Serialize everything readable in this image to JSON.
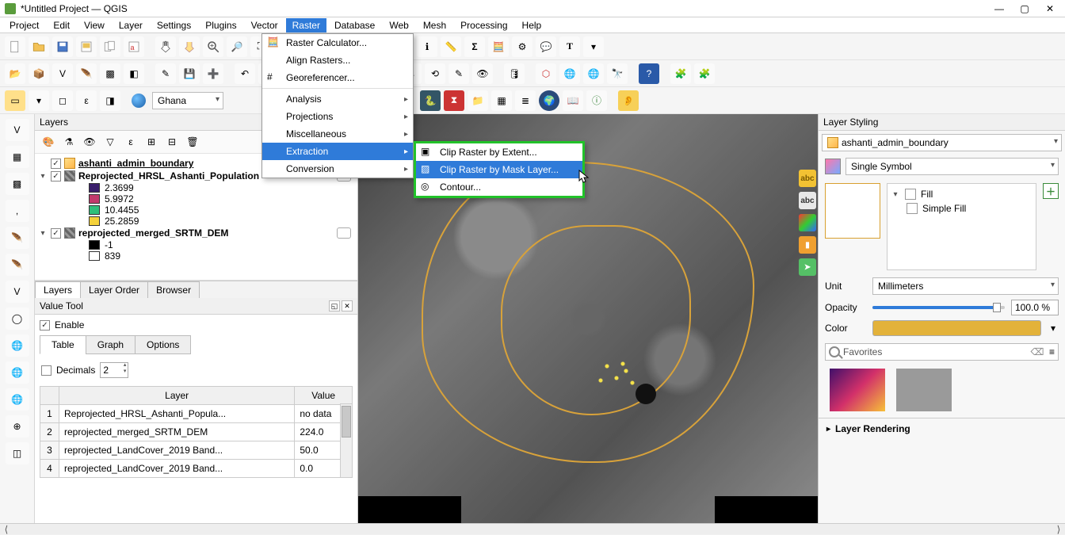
{
  "window": {
    "title": "*Untitled Project — QGIS"
  },
  "menu": {
    "items": [
      "Project",
      "Edit",
      "View",
      "Layer",
      "Settings",
      "Plugins",
      "Vector",
      "Raster",
      "Database",
      "Web",
      "Mesh",
      "Processing",
      "Help"
    ],
    "active": "Raster"
  },
  "raster_menu": {
    "items": [
      {
        "label": "Raster Calculator...",
        "icon": "calculator-icon"
      },
      {
        "label": "Align Rasters...",
        "icon": ""
      },
      {
        "label": "Georeferencer...",
        "icon": "georef-icon"
      },
      {
        "label": "Analysis",
        "submenu": true
      },
      {
        "label": "Projections",
        "submenu": true
      },
      {
        "label": "Miscellaneous",
        "submenu": true
      },
      {
        "label": "Extraction",
        "submenu": true,
        "hover": true
      },
      {
        "label": "Conversion",
        "submenu": true
      }
    ]
  },
  "extraction_submenu": {
    "items": [
      {
        "label": "Clip Raster by Extent...",
        "icon": "clip-extent-icon"
      },
      {
        "label": "Clip Raster by Mask Layer...",
        "icon": "clip-mask-icon",
        "hover": true
      },
      {
        "label": "Contour...",
        "icon": "contour-icon"
      }
    ]
  },
  "toolbar": {
    "location_combo": "Ghana"
  },
  "panels": {
    "layers_title": "Layers",
    "value_tool_title": "Value Tool",
    "layer_styling_title": "Layer Styling"
  },
  "layers": {
    "tree": [
      {
        "type": "vector",
        "name": "ashanti_admin_boundary",
        "checked": true,
        "underline": true
      },
      {
        "type": "raster",
        "name": "Reprojected_HRSL_Ashanti_Population",
        "checked": true,
        "expanded": true,
        "legend": [
          {
            "color": "#3a1e6b",
            "label": "2.3699"
          },
          {
            "color": "#c23a6b",
            "label": "5.9972"
          },
          {
            "color": "#2fbf7a",
            "label": "10.4455"
          },
          {
            "color": "#f5d23a",
            "label": "25.2859"
          }
        ]
      },
      {
        "type": "raster",
        "name": "reprojected_merged_SRTM_DEM",
        "checked": true,
        "expanded": true,
        "legend": [
          {
            "color": "#000000",
            "label": "-1"
          },
          {
            "color": "#ffffff",
            "label": "839"
          }
        ]
      }
    ],
    "tabs": [
      "Layers",
      "Layer Order",
      "Browser"
    ],
    "active_tab": "Layers"
  },
  "value_tool": {
    "enable_label": "Enable",
    "enable_checked": true,
    "tabs": [
      "Table",
      "Graph",
      "Options"
    ],
    "active_tab": "Table",
    "decimals_label": "Decimals",
    "decimals_value": "2",
    "table": {
      "headers": [
        "",
        "Layer",
        "Value"
      ],
      "rows": [
        {
          "n": "1",
          "layer": "Reprojected_HRSL_Ashanti_Popula...",
          "value": "no data"
        },
        {
          "n": "2",
          "layer": "reprojected_merged_SRTM_DEM",
          "value": "224.0"
        },
        {
          "n": "3",
          "layer": "reprojected_LandCover_2019 Band...",
          "value": "50.0"
        },
        {
          "n": "4",
          "layer": "reprojected_LandCover_2019 Band...",
          "value": "0.0"
        }
      ]
    }
  },
  "layer_styling": {
    "layer_combo": "ashanti_admin_boundary",
    "symbol_label": "Single Symbol",
    "fill_label": "Fill",
    "simple_fill_label": "Simple Fill",
    "unit_label": "Unit",
    "unit_value": "Millimeters",
    "opacity_label": "Opacity",
    "opacity_value": "100.0 %",
    "opacity_pct": 94,
    "color_label": "Color",
    "color_value": "#e3b23a",
    "favorites_placeholder": "Favorites",
    "layer_rendering_label": "Layer Rendering"
  },
  "map_chips": [
    "abc",
    "abc",
    "cube",
    "bars",
    "arr"
  ]
}
